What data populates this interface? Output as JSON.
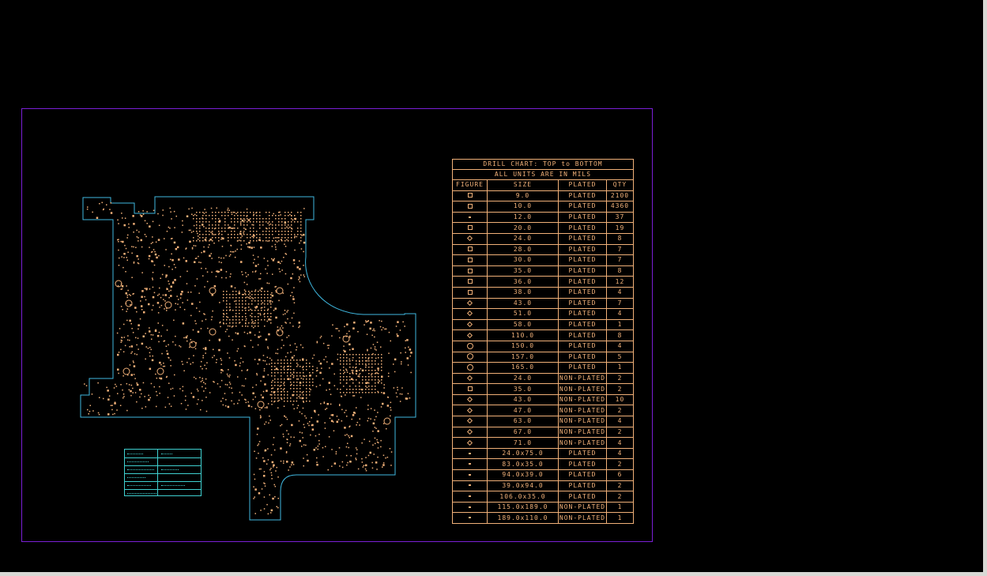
{
  "drill_chart": {
    "title": "DRILL CHART: TOP to BOTTOM",
    "subtitle": "ALL UNITS ARE IN MILS",
    "headers": [
      "FIGURE",
      "SIZE",
      "PLATED",
      "QTY"
    ],
    "rows": [
      {
        "figure": "square",
        "size": "9.0",
        "plated": "PLATED",
        "qty": "2100"
      },
      {
        "figure": "square",
        "size": "10.0",
        "plated": "PLATED",
        "qty": "4360"
      },
      {
        "figure": "slash",
        "size": "12.0",
        "plated": "PLATED",
        "qty": "37"
      },
      {
        "figure": "square",
        "size": "20.0",
        "plated": "PLATED",
        "qty": "19"
      },
      {
        "figure": "diamond",
        "size": "24.0",
        "plated": "PLATED",
        "qty": "8"
      },
      {
        "figure": "square",
        "size": "28.0",
        "plated": "PLATED",
        "qty": "7"
      },
      {
        "figure": "square",
        "size": "30.0",
        "plated": "PLATED",
        "qty": "7"
      },
      {
        "figure": "square",
        "size": "35.0",
        "plated": "PLATED",
        "qty": "8"
      },
      {
        "figure": "square",
        "size": "36.0",
        "plated": "PLATED",
        "qty": "12"
      },
      {
        "figure": "square",
        "size": "38.0",
        "plated": "PLATED",
        "qty": "4"
      },
      {
        "figure": "triangle",
        "size": "43.0",
        "plated": "PLATED",
        "qty": "7"
      },
      {
        "figure": "diamond",
        "size": "51.0",
        "plated": "PLATED",
        "qty": "4"
      },
      {
        "figure": "diamond",
        "size": "58.0",
        "plated": "PLATED",
        "qty": "1"
      },
      {
        "figure": "diamond",
        "size": "110.0",
        "plated": "PLATED",
        "qty": "8"
      },
      {
        "figure": "circle",
        "size": "150.0",
        "plated": "PLATED",
        "qty": "4"
      },
      {
        "figure": "circle",
        "size": "157.0",
        "plated": "PLATED",
        "qty": "5"
      },
      {
        "figure": "circle",
        "size": "165.0",
        "plated": "PLATED",
        "qty": "1"
      },
      {
        "figure": "diamond",
        "size": "24.0",
        "plated": "NON-PLATED",
        "qty": "2"
      },
      {
        "figure": "square",
        "size": "35.0",
        "plated": "NON-PLATED",
        "qty": "2"
      },
      {
        "figure": "triangle",
        "size": "43.0",
        "plated": "NON-PLATED",
        "qty": "10"
      },
      {
        "figure": "triangle",
        "size": "47.0",
        "plated": "NON-PLATED",
        "qty": "2"
      },
      {
        "figure": "triangle",
        "size": "63.0",
        "plated": "NON-PLATED",
        "qty": "4"
      },
      {
        "figure": "triangle",
        "size": "67.0",
        "plated": "NON-PLATED",
        "qty": "2"
      },
      {
        "figure": "triangle",
        "size": "71.0",
        "plated": "NON-PLATED",
        "qty": "4"
      },
      {
        "figure": "slot",
        "size": "24.0x75.0",
        "plated": "PLATED",
        "qty": "4"
      },
      {
        "figure": "slot",
        "size": "83.0x35.0",
        "plated": "PLATED",
        "qty": "2"
      },
      {
        "figure": "slot",
        "size": "94.0x39.0",
        "plated": "PLATED",
        "qty": "6"
      },
      {
        "figure": "slot",
        "size": "39.0x94.0",
        "plated": "PLATED",
        "qty": "2"
      },
      {
        "figure": "slot",
        "size": "106.0x35.0",
        "plated": "PLATED",
        "qty": "2"
      },
      {
        "figure": "slot",
        "size": "115.0x189.0",
        "plated": "NON-PLATED",
        "qty": "1"
      },
      {
        "figure": "slot",
        "size": "189.0x110.0",
        "plated": "NON-PLATED",
        "qty": "1"
      }
    ]
  },
  "colors": {
    "background": "#000000",
    "board_outline": "#3fb8e0",
    "components": "#f0b078",
    "sheet_frame": "#7a1fd6",
    "legend": "#3fd0d0"
  }
}
